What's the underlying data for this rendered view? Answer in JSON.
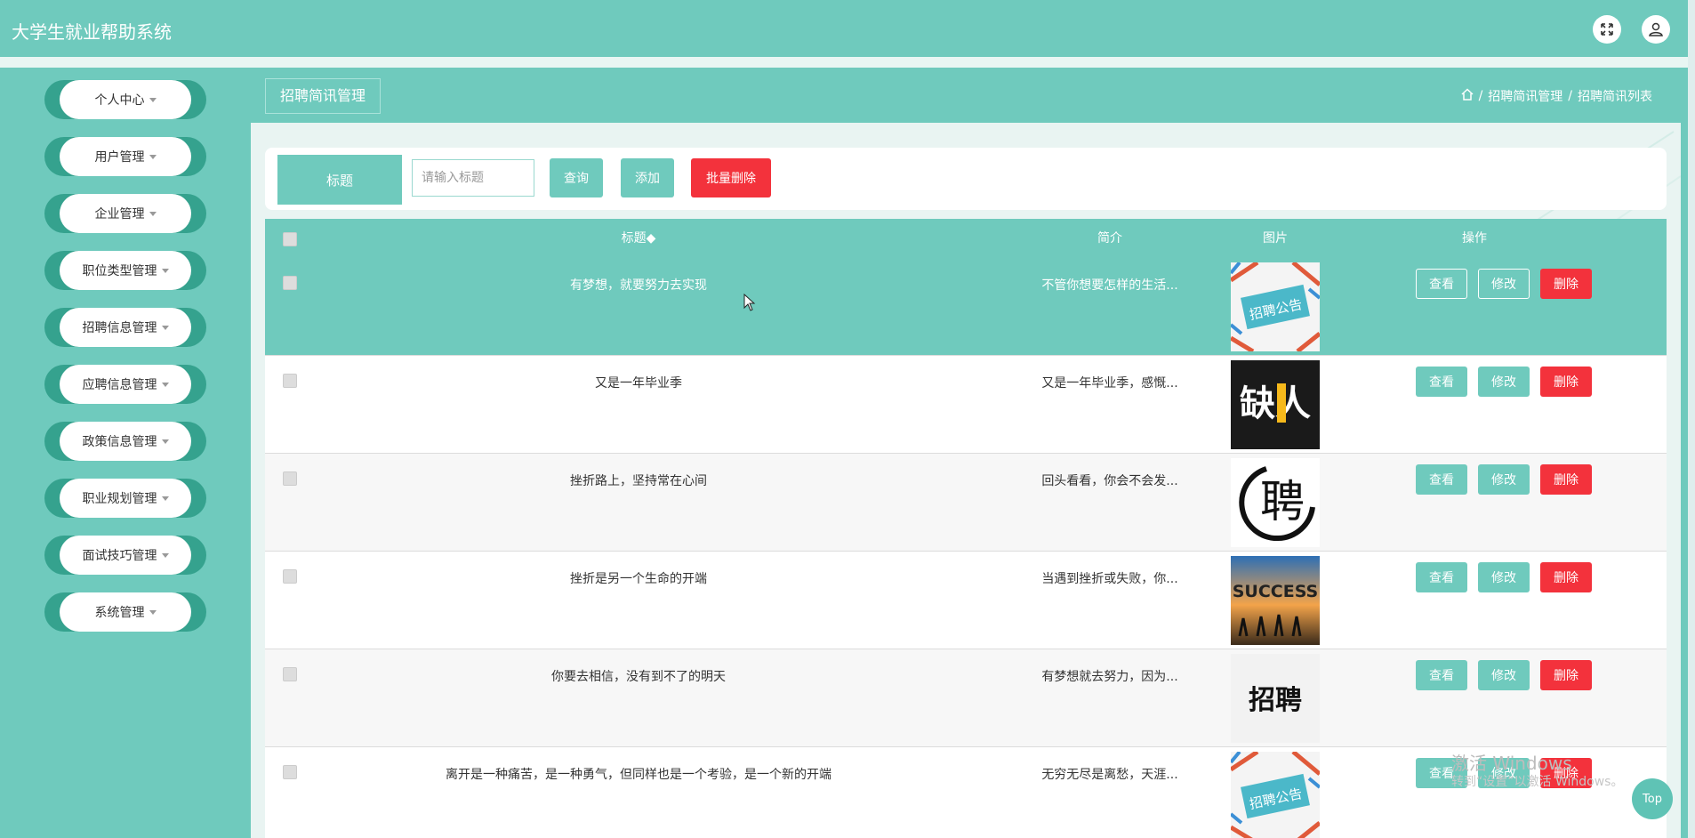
{
  "app": {
    "title": "大学生就业帮助系统"
  },
  "header": {
    "icons": [
      "fullscreen-icon",
      "user-icon"
    ]
  },
  "sidebar": {
    "items": [
      {
        "label": "个人中心"
      },
      {
        "label": "用户管理"
      },
      {
        "label": "企业管理"
      },
      {
        "label": "职位类型管理"
      },
      {
        "label": "招聘信息管理"
      },
      {
        "label": "应聘信息管理"
      },
      {
        "label": "政策信息管理"
      },
      {
        "label": "职业规划管理"
      },
      {
        "label": "面试技巧管理"
      },
      {
        "label": "系统管理"
      }
    ]
  },
  "page": {
    "section_title": "招聘简讯管理",
    "breadcrumb": [
      "招聘简讯管理",
      "招聘简讯列表"
    ],
    "breadcrumb_separator": "/"
  },
  "search": {
    "label": "标题",
    "placeholder": "请输入标题",
    "query_label": "查询",
    "add_label": "添加",
    "batch_delete_label": "批量删除"
  },
  "table": {
    "columns": [
      "标题◆",
      "简介",
      "图片",
      "操作"
    ],
    "actions": {
      "view": "查看",
      "edit": "修改",
      "delete": "删除"
    },
    "rows": [
      {
        "title": "有梦想，就要努力去实现",
        "summary": "不管你想要怎样的生活...",
        "image": "招聘公告",
        "highlighted": true
      },
      {
        "title": "又是一年毕业季",
        "summary": "又是一年毕业季，感慨...",
        "image": "缺人",
        "highlighted": false
      },
      {
        "title": "挫折路上，坚持常在心间",
        "summary": "回头看看，你会不会发...",
        "image": "聘",
        "highlighted": false
      },
      {
        "title": "挫折是另一个生命的开端",
        "summary": "当遇到挫折或失败，你...",
        "image": "SUCCESS",
        "highlighted": false
      },
      {
        "title": "你要去相信，没有到不了的明天",
        "summary": "有梦想就去努力，因为...",
        "image": "招聘",
        "highlighted": false
      },
      {
        "title": "离开是一种痛苦，是一种勇气，但同样也是一个考验，是一个新的开端",
        "summary": "无穷无尽是离愁，天涯...",
        "image": "招聘公告",
        "highlighted": false
      }
    ]
  },
  "overlay": {
    "watermark_line1": "激活 Windows",
    "watermark_line2": "转到“设置”以激活 Windows。",
    "top_button": "Top"
  },
  "colors": {
    "primary": "#6fcabd",
    "accent_dark": "#35a28e",
    "danger": "#f3323c"
  }
}
